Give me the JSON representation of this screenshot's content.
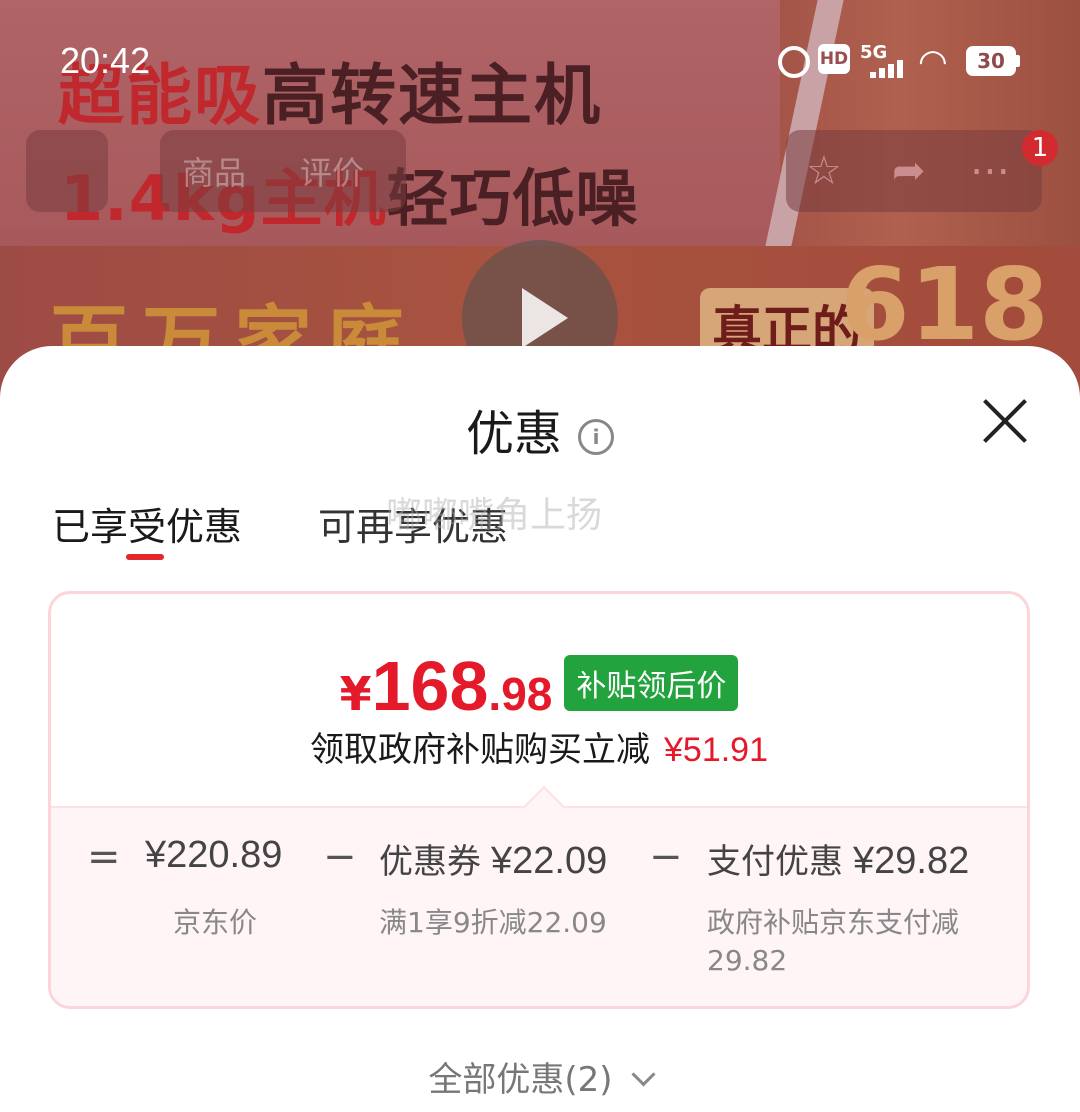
{
  "status_bar": {
    "time": "20:42",
    "hd": "HD",
    "network": "5G",
    "battery": "30"
  },
  "banner": {
    "line1_red": "超能吸",
    "line1_dark": "高转速主机",
    "line2_red": "1.4kg主机",
    "line2_dark": "轻巧低噪",
    "slogan": "百万家庭",
    "zhen": "真正的",
    "num": "618"
  },
  "nav": {
    "tabs": [
      "商品",
      "评价"
    ],
    "star_icon": "star-icon",
    "share_icon": "share-icon",
    "more_icon": "more-icon",
    "badge": "1"
  },
  "sheet": {
    "title": "优惠",
    "info_icon": "i",
    "tabs": [
      "已享受优惠",
      "可再享优惠"
    ],
    "watermark": "嘟嘟嘴角上扬",
    "price": {
      "currency": "¥",
      "integer": "168",
      "decimal": ".98",
      "tag": "补贴领后价"
    },
    "subsidy": {
      "text": "领取政府补贴购买立减",
      "amount": "¥51.91"
    },
    "breakdown": {
      "eq": "=",
      "minus": "−",
      "jd_value": "¥220.89",
      "jd_label": "京东价",
      "coupon_label": "优惠券",
      "coupon_value": "¥22.09",
      "coupon_desc": "满1享9折减22.09",
      "pay_label": "支付优惠",
      "pay_value": "¥29.82",
      "pay_desc": "政府补贴京东支付减\n29.82"
    },
    "all_offers": "全部优惠(2)"
  },
  "colors": {
    "accent_red": "#e4192a",
    "tag_green": "#23a33e",
    "card_border": "#fbd5da"
  }
}
